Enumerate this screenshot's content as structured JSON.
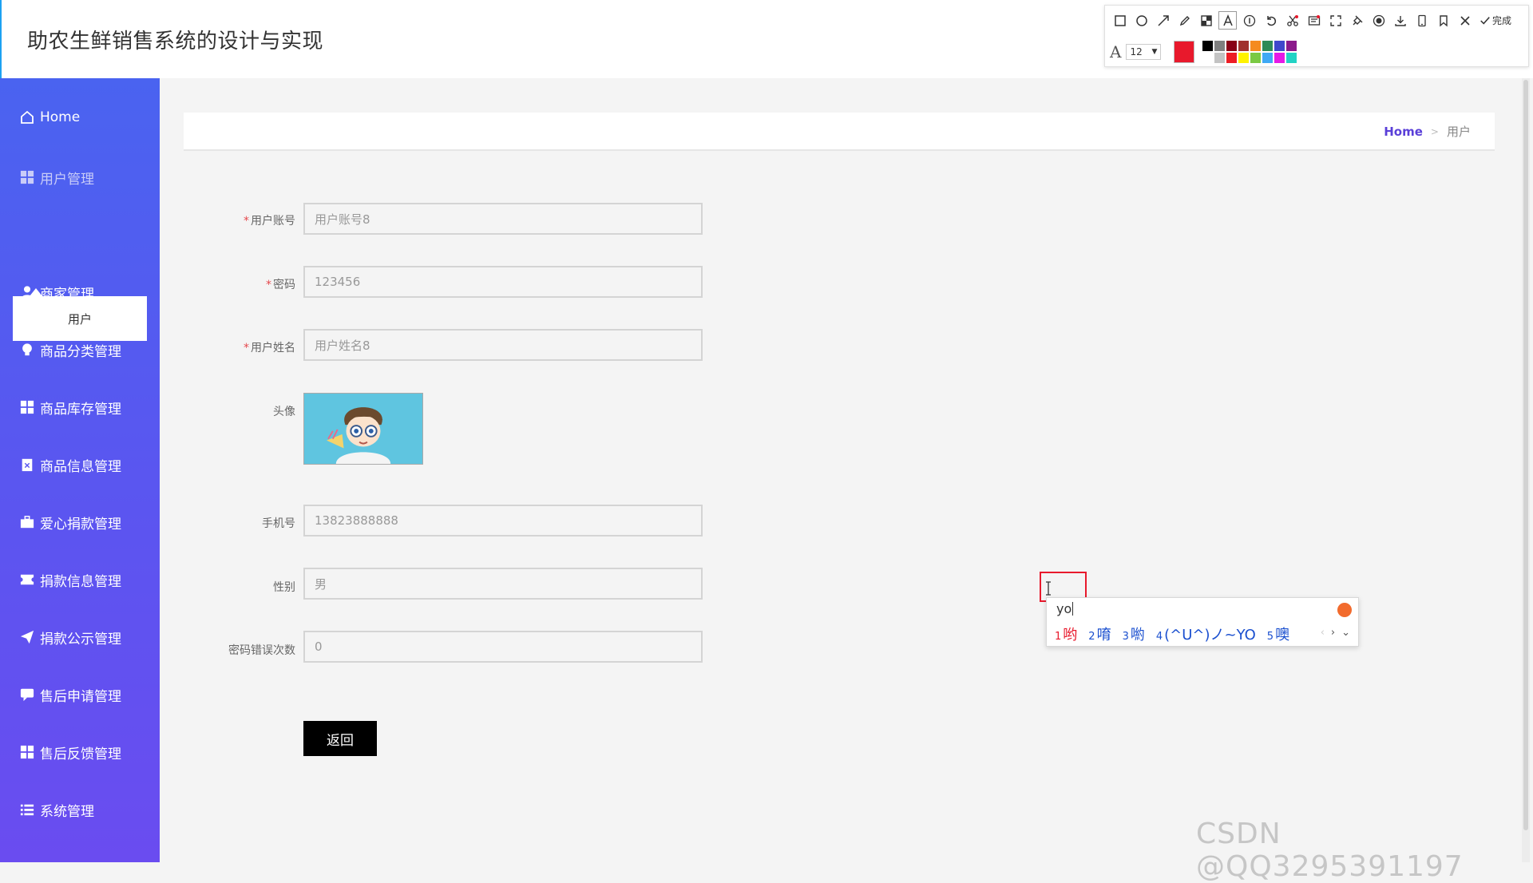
{
  "header": {
    "title": "助农生鲜销售系统的设计与实现"
  },
  "annotation_toolbar": {
    "done_label": "完成",
    "font_size": "12",
    "current_color": "#e8192c",
    "palette": [
      "#000000",
      "#7f7f7f",
      "#880015",
      "#a0312d",
      "#f58b1f",
      "#2e8b57",
      "#3f48cc",
      "#8b1a8b",
      "#ffffff",
      "#c3c3c3",
      "#ed1c24",
      "#fff200",
      "#7ac943",
      "#3fa9f5",
      "#e619e6",
      "#22d3c5"
    ]
  },
  "sidebar": {
    "items": [
      {
        "label": "Home",
        "icon": "home-icon"
      },
      {
        "label": "用户管理",
        "icon": "grid-icon"
      },
      {
        "label": "商家管理",
        "icon": "user-icon"
      },
      {
        "label": "商品分类管理",
        "icon": "bulb-icon"
      },
      {
        "label": "商品库存管理",
        "icon": "grid-icon"
      },
      {
        "label": "商品信息管理",
        "icon": "clipboard-icon"
      },
      {
        "label": "爱心捐款管理",
        "icon": "briefcase-icon"
      },
      {
        "label": "捐款信息管理",
        "icon": "ticket-icon"
      },
      {
        "label": "捐款公示管理",
        "icon": "send-icon"
      },
      {
        "label": "售后申请管理",
        "icon": "chat-icon"
      },
      {
        "label": "售后反馈管理",
        "icon": "grid-icon"
      },
      {
        "label": "系统管理",
        "icon": "list-icon"
      }
    ],
    "sub_item": "用户"
  },
  "breadcrumb": {
    "home": "Home",
    "separator": ">",
    "current": "用户"
  },
  "form": {
    "account_label": "用户账号",
    "account_value": "用户账号8",
    "password_label": "密码",
    "password_value": "123456",
    "name_label": "用户姓名",
    "name_value": "用户姓名8",
    "avatar_label": "头像",
    "phone_label": "手机号",
    "phone_value": "13823888888",
    "gender_label": "性别",
    "gender_value": "男",
    "errors_label": "密码错误次数",
    "errors_value": "0",
    "required_mark": "*",
    "back_label": "返回"
  },
  "ime": {
    "input": "yo",
    "candidates": [
      {
        "num": "1",
        "text": "哟"
      },
      {
        "num": "2",
        "text": "唷"
      },
      {
        "num": "3",
        "text": "喲"
      },
      {
        "num": "4",
        "text": "(^U^)ノ~YO"
      },
      {
        "num": "5",
        "text": "噢"
      }
    ],
    "prev": "‹",
    "next": "›",
    "expand": "⌄"
  },
  "watermark": "CSDN @QQ3295391197"
}
